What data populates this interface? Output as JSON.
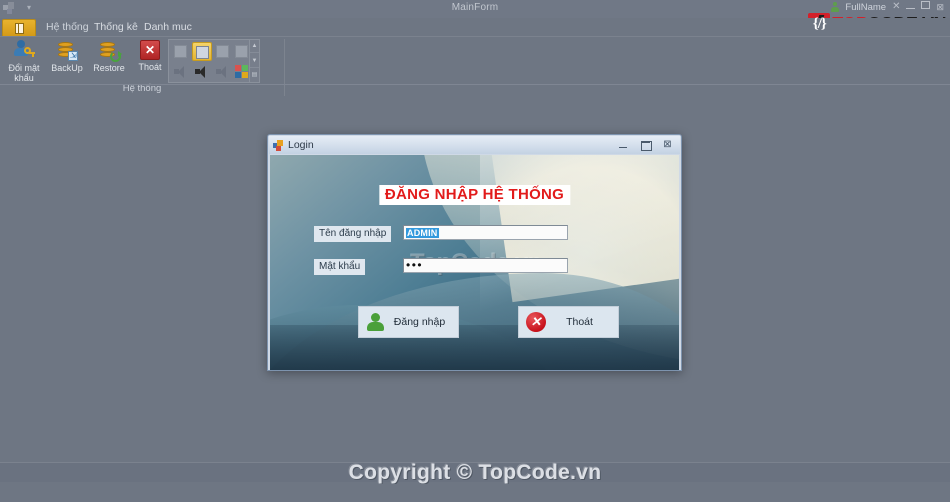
{
  "app": {
    "title": "MainForm",
    "user_label": "FullName",
    "qat_dropdown_icon": "chevron-down-icon",
    "app_icon": "app-logo-icon",
    "window_buttons": {
      "help": "help-icon",
      "minimize": "minimize-icon",
      "restore": "restore-icon",
      "close": "close-icon"
    }
  },
  "branding": {
    "logo_mark": "{/}",
    "logo_text_1": "TOP",
    "logo_text_2": "CODE.VN",
    "accent_red": "#d4202a",
    "watermark": "Copyright © TopCode.vn",
    "dialog_watermark": "TopCode.vn"
  },
  "ribbon": {
    "file_tab": "file-menu-icon",
    "tabs": [
      {
        "label": "Hệ thống",
        "active": true
      },
      {
        "label": "Thống kê",
        "active": false
      },
      {
        "label": "Danh muc",
        "active": false
      }
    ],
    "group_label": "Hệ thống",
    "buttons": [
      {
        "label": "Đổi mật\nkhẩu",
        "line1": "Đổi mật",
        "line2": "khẩu",
        "icon": "user-key-icon"
      },
      {
        "label": "BackUp",
        "line1": "BackUp",
        "line2": "",
        "icon": "database-backup-icon"
      },
      {
        "label": "Restore",
        "line1": "Restore",
        "line2": "",
        "icon": "database-restore-icon"
      },
      {
        "label": "Thoát",
        "line1": "Thoát",
        "line2": "",
        "icon": "red-x-icon"
      }
    ],
    "gallery": {
      "row1": [
        "document-icon",
        "document-selected-icon",
        "document-copy-icon",
        "document-stack-icon"
      ],
      "row2": [
        "speaker-left-icon",
        "speaker-active-icon",
        "speaker-muted-icon",
        "windows-flag-icon"
      ],
      "scroll_up": "▲",
      "scroll_down": "▼",
      "scroll_more": "▤"
    },
    "collapse_icon": "collapse-ribbon-icon"
  },
  "login_dialog": {
    "title": "Login",
    "icon": "login-window-icon",
    "heading": "ĐĂNG NHẬP HỆ THỐNG",
    "fields": [
      {
        "label": "Tên đăng nhập",
        "name": "username",
        "value": "ADMIN",
        "placeholder": "",
        "selected": true
      },
      {
        "label": "Mật khẩu",
        "name": "password",
        "value": "•••",
        "placeholder": "",
        "masked": true
      }
    ],
    "buttons": [
      {
        "label": "Đăng nhập",
        "icon": "person-green-icon",
        "name": "login"
      },
      {
        "label": "Thoát",
        "icon": "x-circle-red-icon",
        "name": "exit"
      }
    ],
    "window_buttons": {
      "minimize": "minimize-icon",
      "maximize": "maximize-icon",
      "close": "close-icon"
    },
    "heading_color": "#e21b1b"
  }
}
